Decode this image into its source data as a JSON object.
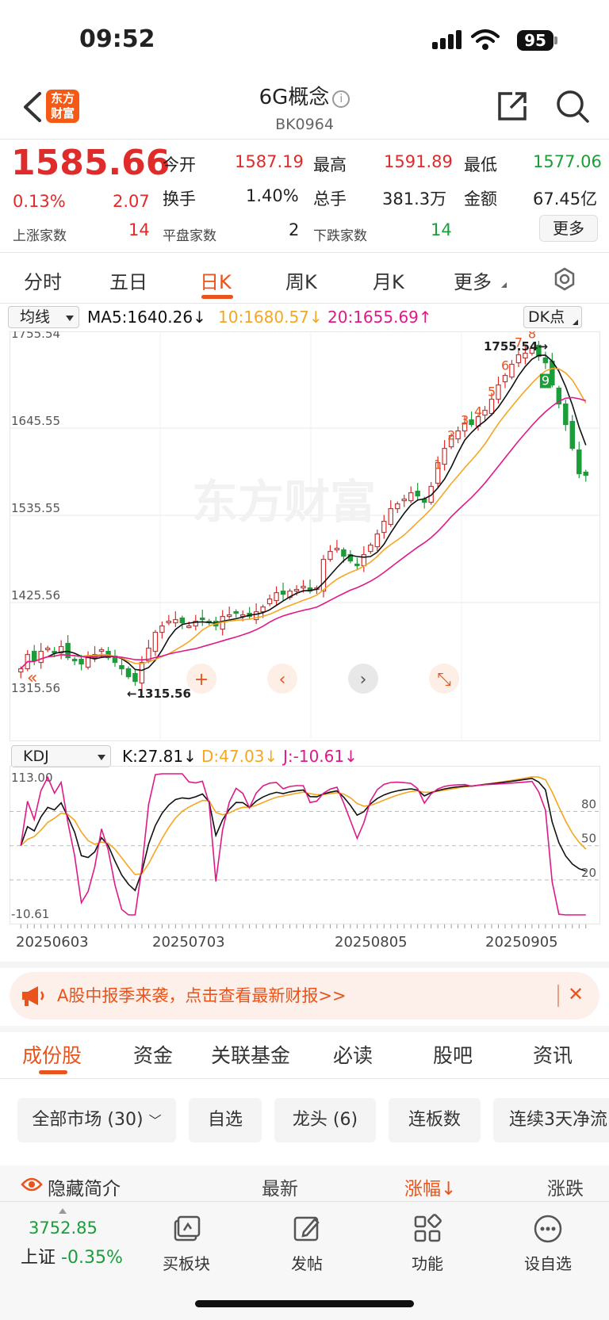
{
  "status": {
    "time": "09:52",
    "battery": "95"
  },
  "header": {
    "logo": "东方财富",
    "title": "6G概念",
    "code": "BK0964"
  },
  "quote": {
    "price": "1585.66",
    "change_pct": "0.13%",
    "change": "2.07",
    "open_label": "今开",
    "open": "1587.19",
    "high_label": "最高",
    "high": "1591.89",
    "low_label": "最低",
    "low": "1577.06",
    "turnover_label": "换手",
    "turnover": "1.40%",
    "volume_label": "总手",
    "volume": "381.3万",
    "amount_label": "金额",
    "amount": "67.45亿",
    "up_label": "上涨家数",
    "up": "14",
    "flat_label": "平盘家数",
    "flat": "2",
    "down_label": "下跌家数",
    "down": "14",
    "more": "更多"
  },
  "tabs": [
    "分时",
    "五日",
    "日K",
    "周K",
    "月K",
    "更多"
  ],
  "ma_bar": {
    "select": "均线",
    "ma5": "MA5:1640.26↓",
    "ma10": "10:1680.57↓",
    "ma20": "20:1655.69↑",
    "dk": "DK点"
  },
  "kdj_bar": {
    "select": "KDJ",
    "k": "K:27.81↓",
    "d": "D:47.03↓",
    "j": "J:-10.61↓"
  },
  "colors": {
    "up": "#e02b2b",
    "down": "#1a9e3a",
    "ma5": "#111111",
    "ma10": "#f5a623",
    "ma20": "#e0198a",
    "accent": "#e8541c"
  },
  "chart_data": [
    {
      "type": "candlestick",
      "y_ticks": [
        "1755.54",
        "1645.55",
        "1535.55",
        "1425.56",
        "1315.56"
      ],
      "ylim": [
        1315.56,
        1755.54
      ],
      "high_marker": "1755.54",
      "low_marker": "1315.56",
      "watermark": "东方财富",
      "dates": [
        "20250603",
        "20250703",
        "20250805",
        "20250905"
      ],
      "td_labels": [
        "1",
        "2",
        "3",
        "4",
        "5",
        "6",
        "7",
        "8",
        "9"
      ],
      "closes": [
        1342,
        1360,
        1352,
        1364,
        1368,
        1362,
        1370,
        1356,
        1352,
        1348,
        1356,
        1360,
        1366,
        1356,
        1350,
        1342,
        1332,
        1326,
        1350,
        1368,
        1388,
        1396,
        1402,
        1404,
        1400,
        1396,
        1402,
        1404,
        1400,
        1396,
        1408,
        1410,
        1412,
        1410,
        1408,
        1414,
        1420,
        1430,
        1438,
        1436,
        1440,
        1442,
        1446,
        1440,
        1444,
        1480,
        1490,
        1494,
        1484,
        1478,
        1472,
        1486,
        1498,
        1512,
        1528,
        1544,
        1550,
        1556,
        1564,
        1560,
        1552,
        1572,
        1602,
        1620,
        1636,
        1642,
        1652,
        1650,
        1660,
        1668,
        1682,
        1700,
        1712,
        1726,
        1738,
        1740,
        1746,
        1736,
        1728,
        1700,
        1676,
        1650,
        1620,
        1588,
        1586
      ]
    },
    {
      "type": "line",
      "y_ticks": [
        "113.00",
        "-10.61"
      ],
      "ref_lines": [
        "80",
        "50",
        "20"
      ],
      "series": [
        {
          "name": "K",
          "values": [
            27.81
          ]
        },
        {
          "name": "D",
          "values": [
            47.03
          ]
        },
        {
          "name": "J",
          "values": [
            -10.61
          ]
        }
      ]
    }
  ],
  "banner": {
    "text": "A股中报季来袭，点击查看最新财报>>"
  },
  "sub_tabs": [
    "成份股",
    "资金",
    "关联基金",
    "必读",
    "股吧",
    "资讯"
  ],
  "filters": [
    "全部市场 (30)",
    "自选",
    "龙头 (6)",
    "连板数",
    "连续3天净流"
  ],
  "list_header": {
    "hide": "隐藏简介",
    "latest": "最新",
    "change": "涨幅↓",
    "change2": "涨跌"
  },
  "bottom_bar": {
    "index_value": "3752.85",
    "index_name": "上证",
    "index_change": "-0.35%",
    "items": [
      "买板块",
      "发帖",
      "功能",
      "设自选"
    ]
  }
}
